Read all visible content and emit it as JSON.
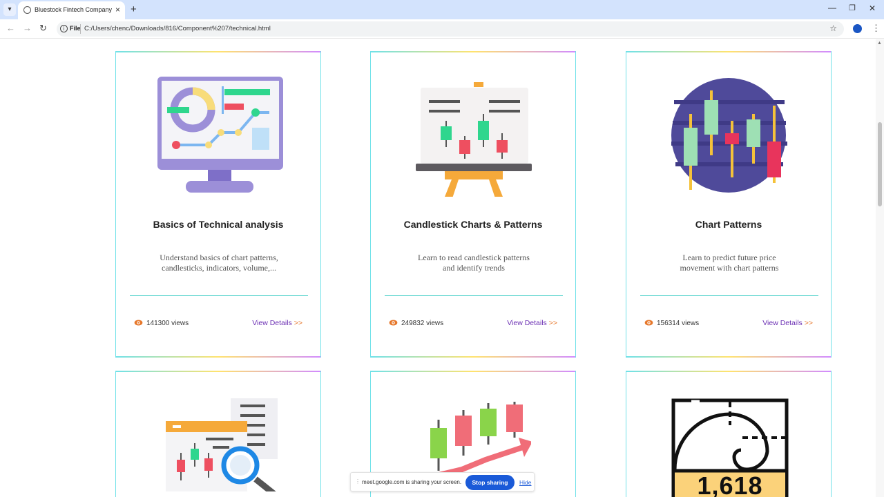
{
  "browser": {
    "tab_title": "Bluestock Fintech Company",
    "address_scheme": "File",
    "address_url": "C:/Users/chenc/Downloads/816/Component%207/technical.html"
  },
  "cards": [
    {
      "title": "Basics of Technical analysis",
      "desc_line1": "Understand basics of chart patterns,",
      "desc_line2": "candlesticks, indicators, volume,...",
      "views": "141300 views",
      "link_label": "View Details",
      "link_arrows": ">>"
    },
    {
      "title": "Candlestick Charts & Patterns",
      "desc_line1": "Learn to read candlestick patterns",
      "desc_line2": "and identify trends",
      "views": "249832 views",
      "link_label": "View Details",
      "link_arrows": ">>"
    },
    {
      "title": "Chart Patterns",
      "desc_line1": "Learn to predict future price",
      "desc_line2": "movement with chart patterns",
      "views": "156314 views",
      "link_label": "View Details",
      "link_arrows": ">>"
    }
  ],
  "lower_cards": {
    "golden_ratio_value": "1,618"
  },
  "share_bar": {
    "message": "meet.google.com is sharing your screen.",
    "stop_label": "Stop sharing",
    "hide_label": "Hide"
  },
  "colors": {
    "card_border": "#6fe1e8",
    "link": "#6b2fb3",
    "link_arrows": "#e6772a",
    "eye": "#e6772a",
    "rule": "#2ec8c0"
  }
}
